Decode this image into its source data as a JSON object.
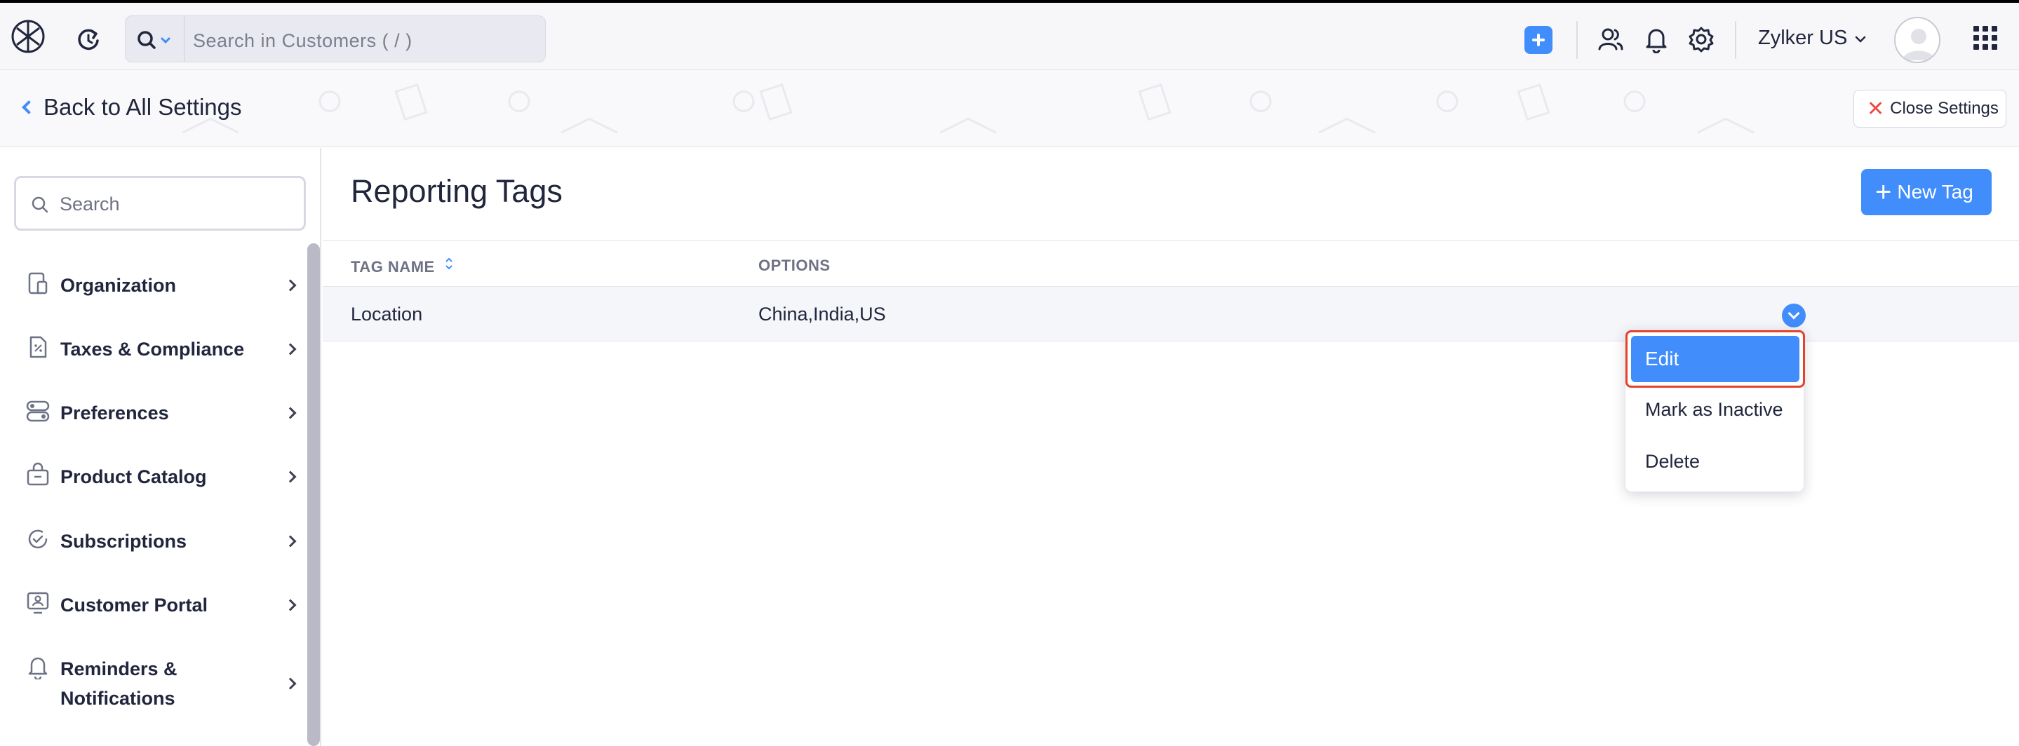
{
  "topbar": {
    "search_placeholder": "Search in Customers ( / )",
    "org_name": "Zylker US",
    "icons": [
      "app-logo-icon",
      "recent-activity-icon",
      "search-icon",
      "chevron-down-icon",
      "quick-create-plus-icon",
      "contacts-icon",
      "bell-icon",
      "gear-icon",
      "user-avatar-icon",
      "apps-grid-icon"
    ]
  },
  "settings_header": {
    "back_label": "Back to All Settings",
    "close_label": "Close Settings"
  },
  "sidebar": {
    "search_placeholder": "Search",
    "items": [
      {
        "label": "Organization",
        "icon": "organization-icon"
      },
      {
        "label": "Taxes & Compliance",
        "icon": "tax-document-icon"
      },
      {
        "label": "Preferences",
        "icon": "toggles-icon"
      },
      {
        "label": "Product Catalog",
        "icon": "basket-icon"
      },
      {
        "label": "Subscriptions",
        "icon": "subscription-cycle-icon"
      },
      {
        "label": "Customer Portal",
        "icon": "portal-screen-icon"
      },
      {
        "label": "Reminders &\nNotifications",
        "label_line1": "Reminders &",
        "label_line2": "Notifications",
        "icon": "bell-icon"
      }
    ]
  },
  "main": {
    "title": "Reporting Tags",
    "new_button": "New Tag",
    "columns": [
      "TAG NAME",
      "OPTIONS"
    ],
    "rows": [
      {
        "tag_name": "Location",
        "options": "China,India,US"
      }
    ],
    "row_menu": {
      "items": [
        "Edit",
        "Mark as Inactive",
        "Delete"
      ],
      "highlighted": "Edit"
    }
  },
  "colors": {
    "accent": "#408dfb",
    "highlight_border": "#e4432a",
    "close_x": "#f0483e",
    "text": "#21263c"
  }
}
